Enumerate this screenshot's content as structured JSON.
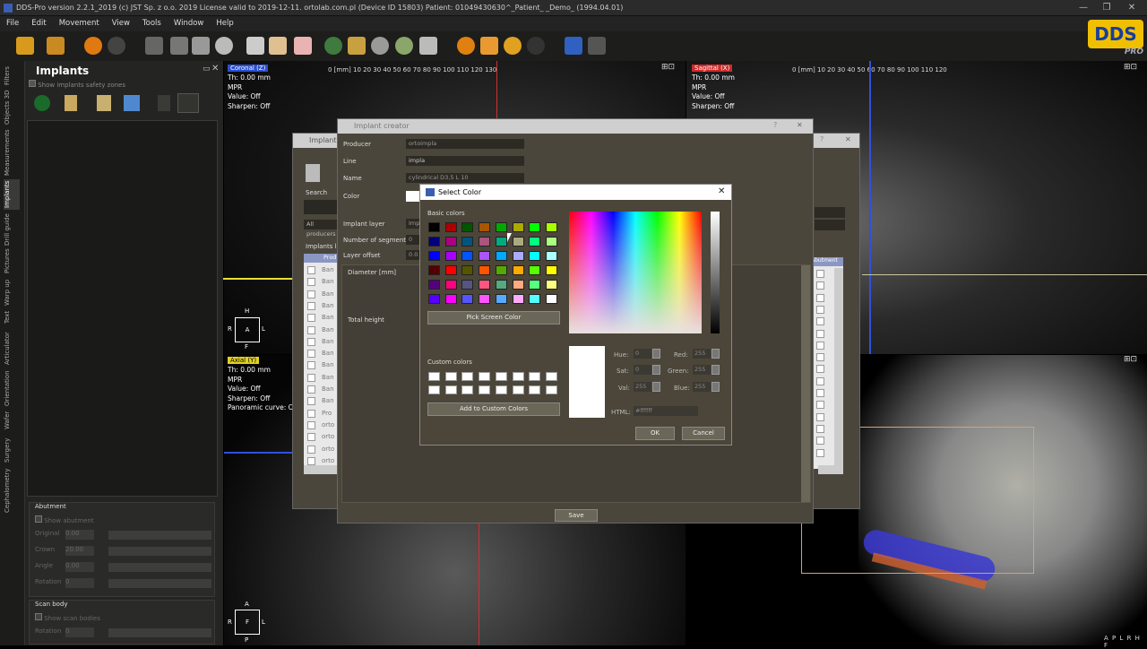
{
  "window": {
    "title": "DDS-Pro version 2.2.1_2019 (c) JST Sp. z o.o. 2019 License valid to 2019-12-11. ortolab.com.pl (Device ID 15803) Patient: 01049430630^_Patient_ _Demo_ (1994.04.01)"
  },
  "menu": [
    "File",
    "Edit",
    "Movement",
    "View",
    "Tools",
    "Window",
    "Help"
  ],
  "logo": {
    "text": "DDS",
    "sub": "PRO"
  },
  "left_tabs": [
    "Filters",
    "Objects 3D",
    "Measurements",
    "Implants",
    "Drill guide",
    "Pictures",
    "Warp up",
    "Text",
    "Articulator",
    "Orientation",
    "Wafer",
    "Surgery",
    "Cephalometry"
  ],
  "implants_panel": {
    "title": "Implants",
    "safety_label": "Show implants safety zones",
    "abutment": {
      "title": "Abutment",
      "show": "Show abutment",
      "rows": [
        {
          "label": "Original",
          "value": "0.00"
        },
        {
          "label": "Crown",
          "value": "20.00"
        },
        {
          "label": "Angle",
          "value": "0.00"
        },
        {
          "label": "Rotation",
          "value": "0"
        }
      ]
    },
    "scan_body": {
      "title": "Scan body",
      "show": "Show scan bodies",
      "rows": [
        {
          "label": "Rotation",
          "value": "0"
        }
      ]
    }
  },
  "views": {
    "coronal": {
      "label": "Coronal (Z)",
      "info": [
        "Th: 0.00 mm",
        "MPR",
        "Value: Off",
        "Sharpen: Off"
      ],
      "ruler": "0 [mm]  10    20    30    40    50    60    70    80    90   100   110   120   130"
    },
    "sagittal": {
      "label": "Sagittal (X)",
      "info": [
        "Th: 0.00 mm",
        "MPR",
        "Value: Off",
        "Sharpen: Off"
      ],
      "ruler": "0 [mm]  10    20    30    40    50    60    70    80    90   100   110   120"
    },
    "axial": {
      "label": "Axial (Y)",
      "info": [
        "Th: 0.00 mm",
        "MPR",
        "Value: Off",
        "Sharpen: Off",
        "Panoramic curve: Off"
      ]
    },
    "orient_top": {
      "top": "H",
      "center": "A",
      "left": "R",
      "right": "L",
      "bottom": "F"
    },
    "orient_bottom": {
      "top": "A",
      "center": "F",
      "left": "R",
      "right": "L",
      "bottom": "P"
    },
    "corner_text": "A P L R H F"
  },
  "implants_dialog": {
    "title": "Implants",
    "search": "Search",
    "all_producers": "All producers",
    "list_title": "Implants list",
    "col": "Prod...",
    "rows": [
      "Ban",
      "Ban",
      "Ban",
      "Ban",
      "Ban",
      "Ban",
      "Ban",
      "Ban",
      "Ban",
      "Ban",
      "Ban",
      "Ban",
      "Pro",
      "orto",
      "orto",
      "orto",
      "orto"
    ],
    "right_col": "Abutment"
  },
  "creator": {
    "title": "Implant creator",
    "fields": [
      {
        "label": "Producer",
        "value": "ortoimpla"
      },
      {
        "label": "Line",
        "value": "impla"
      },
      {
        "label": "Name",
        "value": "cylindrical D3,5 L 10"
      },
      {
        "label": "Color",
        "value": ""
      },
      {
        "label": "Implant layer",
        "value": "Impl"
      },
      {
        "label": "Number of segments",
        "value": "0"
      },
      {
        "label": "Layer offset",
        "value": "0.0"
      }
    ],
    "diameter": "Diameter [mm]",
    "total_height": "Total height",
    "save": "Save"
  },
  "color_dialog": {
    "title": "Select Color",
    "basic": "Basic colors",
    "pick": "Pick Screen Color",
    "custom": "Custom colors",
    "add": "Add to Custom Colors",
    "hue": {
      "label": "Hue:",
      "value": "0"
    },
    "sat": {
      "label": "Sat:",
      "value": "0"
    },
    "val": {
      "label": "Val:",
      "value": "255"
    },
    "red": {
      "label": "Red:",
      "value": "255"
    },
    "green": {
      "label": "Green:",
      "value": "255"
    },
    "blue": {
      "label": "Blue:",
      "value": "255"
    },
    "html": {
      "label": "HTML:",
      "value": "#ffffff"
    },
    "ok": "OK",
    "cancel": "Cancel",
    "swatches": [
      "#000000",
      "#aa0000",
      "#005500",
      "#aa5500",
      "#00aa00",
      "#aaaa00",
      "#00ff00",
      "#aaff00",
      "#00007f",
      "#aa007f",
      "#00557f",
      "#aa557f",
      "#00aa7f",
      "#aaaa7f",
      "#00ff7f",
      "#aaff7f",
      "#0000ff",
      "#aa00ff",
      "#0055ff",
      "#aa55ff",
      "#00aaff",
      "#aaaaff",
      "#00ffff",
      "#aaffff",
      "#550000",
      "#ff0000",
      "#555500",
      "#ff5500",
      "#55aa00",
      "#ffaa00",
      "#55ff00",
      "#ffff00",
      "#55007f",
      "#ff007f",
      "#55557f",
      "#ff557f",
      "#55aa7f",
      "#ffaa7f",
      "#55ff7f",
      "#ffff7f",
      "#5500ff",
      "#ff00ff",
      "#5555ff",
      "#ff55ff",
      "#55aaff",
      "#ffaaff",
      "#55ffff",
      "#ffffff"
    ]
  }
}
